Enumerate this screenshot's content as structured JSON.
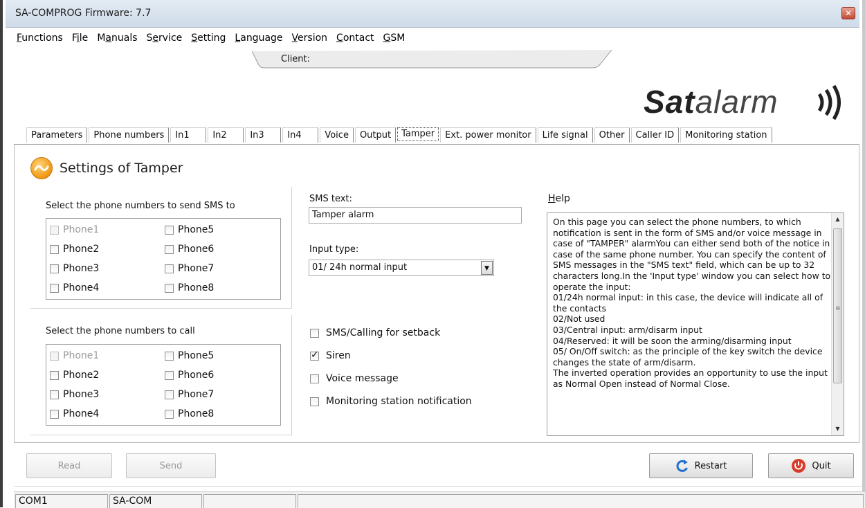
{
  "window": {
    "title": "SA-COMPROG Firmware: 7.7",
    "close_glyph": "✕"
  },
  "menu": [
    {
      "accel": "F",
      "rest": "unctions"
    },
    {
      "accel": "",
      "pre": "F",
      "mid": "i",
      "post": "le"
    },
    {
      "accel": "",
      "pre": "M",
      "mid": "a",
      "post": "nuals"
    },
    {
      "accel": "",
      "pre": "S",
      "mid": "e",
      "post": "rvice"
    },
    {
      "accel": "S",
      "rest": "etting"
    },
    {
      "accel": "L",
      "rest": "anguage"
    },
    {
      "accel": "V",
      "rest": "ersion"
    },
    {
      "accel": "C",
      "rest": "ontact"
    },
    {
      "accel": "G",
      "rest": "SM"
    }
  ],
  "menu_labels": [
    "Functions",
    "File",
    "Manuals",
    "Service",
    "Setting",
    "Language",
    "Version",
    "Contact",
    "GSM"
  ],
  "client_label": "Client:",
  "logo": {
    "bold": "Sat",
    "rest": "alarm"
  },
  "tabs": [
    "Parameters",
    "Phone numbers",
    "In1",
    "In2",
    "In3",
    "In4",
    "Voice",
    "Output",
    "Tamper",
    "Ext. power monitor",
    "Life signal",
    "Other",
    "Caller ID",
    "Monitoring station"
  ],
  "active_tab": "Tamper",
  "page_title": "Settings of Tamper",
  "sms_group": {
    "label": "Select the phone numbers to send SMS to",
    "phones": [
      "Phone1",
      "Phone2",
      "Phone3",
      "Phone4",
      "Phone5",
      "Phone6",
      "Phone7",
      "Phone8"
    ]
  },
  "call_group": {
    "label": "Select the phone numbers to call",
    "phones": [
      "Phone1",
      "Phone2",
      "Phone3",
      "Phone4",
      "Phone5",
      "Phone6",
      "Phone7",
      "Phone8"
    ]
  },
  "sms_text": {
    "label": "SMS text:",
    "value": "Tamper alarm"
  },
  "input_type": {
    "label": "Input type:",
    "value": "01/ 24h normal input"
  },
  "options": {
    "setback": {
      "label": "SMS/Calling for setback",
      "checked": false
    },
    "siren": {
      "label": "Siren",
      "checked": true
    },
    "voice": {
      "label": "Voice message",
      "checked": false
    },
    "monitoring": {
      "label": "Monitoring station notification",
      "checked": false
    }
  },
  "help": {
    "label_accel": "H",
    "label_rest": "elp",
    "text": "On this page you can select the phone numbers, to which notification is sent in the form of SMS and/or voice message in case of \"TAMPER\" alarmYou can either send both of the notice in case of the same phone number. You can specify the content of SMS messages in the \"SMS text\" field, which can be up to 32 characters long.In the 'Input type' window you can select how to operate the input:\n01/24h normal input: in this case, the device will indicate all of the contacts\n02/Not used\n03/Central input: arm/disarm input\n04/Reserved: it will be soon the arming/disarming input\n05/ On/Off switch: as the principle of the key switch the device changes the state of arm/disarm.\nThe inverted operation provides an opportunity to use the input as Normal Open instead of Normal Close."
  },
  "buttons": {
    "read": "Read",
    "send": "Send",
    "restart": "Restart",
    "quit": "Quit"
  },
  "status": [
    "COM1",
    "SA-COM",
    "",
    ""
  ],
  "colors": {
    "restart_icon": "#1f6fd0",
    "quit_icon": "#d93a2a",
    "accent_orange": "#f2a020"
  }
}
